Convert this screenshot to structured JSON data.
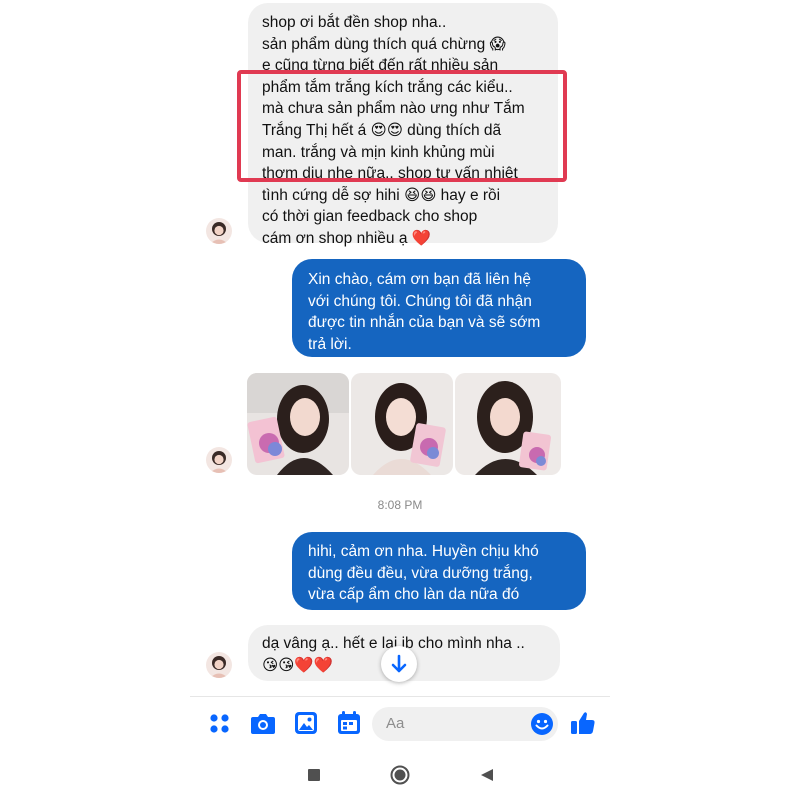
{
  "messages": {
    "incoming_1": {
      "lines": [
        "shop ơi bắt đền shop nha..",
        "sản phẩm dùng thích quá chừng 😱",
        "e cũng từng biết đến rất nhiều sản",
        "phẩm tắm trắng kích trắng các kiểu..",
        "mà chưa sản phẩm nào ưng như Tắm",
        "Trắng Thị hết á 😍😍 dùng thích dã",
        "man. trắng và mịn kinh khủng mùi",
        "thơm dịu nhẹ nữa.. shop tư vấn nhiệt",
        "tình cứng dễ sợ hihi 😆😆 hay e rồi",
        "có thời gian feedback cho shop",
        "cám ơn shop nhiều ạ ❤️"
      ]
    },
    "outgoing_1": {
      "lines": [
        "Xin chào, cám ơn bạn đã liên hệ",
        "với chúng tôi. Chúng tôi đã nhận",
        "được tin nhắn của bạn và sẽ sớm",
        "trả lời."
      ]
    },
    "timestamp": "8:08 PM",
    "outgoing_2": {
      "lines": [
        "hihi, cảm ơn nha. Huyền chịu khó",
        "dùng đều đều, vừa dưỡng trắng,",
        "vừa cấp ẩm cho làn da nữa đó"
      ]
    },
    "incoming_2": {
      "lines": [
        "dạ vâng ạ.. hết e lại ib cho mình nha ..",
        "😘😘❤️❤️"
      ]
    }
  },
  "photos": [
    "photo-1",
    "photo-2",
    "photo-3"
  ],
  "composer": {
    "placeholder": "Aa",
    "icons": [
      "menu-dots-icon",
      "camera-icon",
      "gallery-icon",
      "calendar-icon",
      "emoji-icon",
      "like-icon"
    ]
  },
  "navbar": {
    "icons": [
      "recents-square-icon",
      "home-circle-icon",
      "back-triangle-icon"
    ]
  },
  "colors": {
    "accent": "#0866ff",
    "outgoing_bubble": "#1565c0",
    "incoming_bubble": "#f0f0f0",
    "highlight_box": "#e03a52"
  }
}
